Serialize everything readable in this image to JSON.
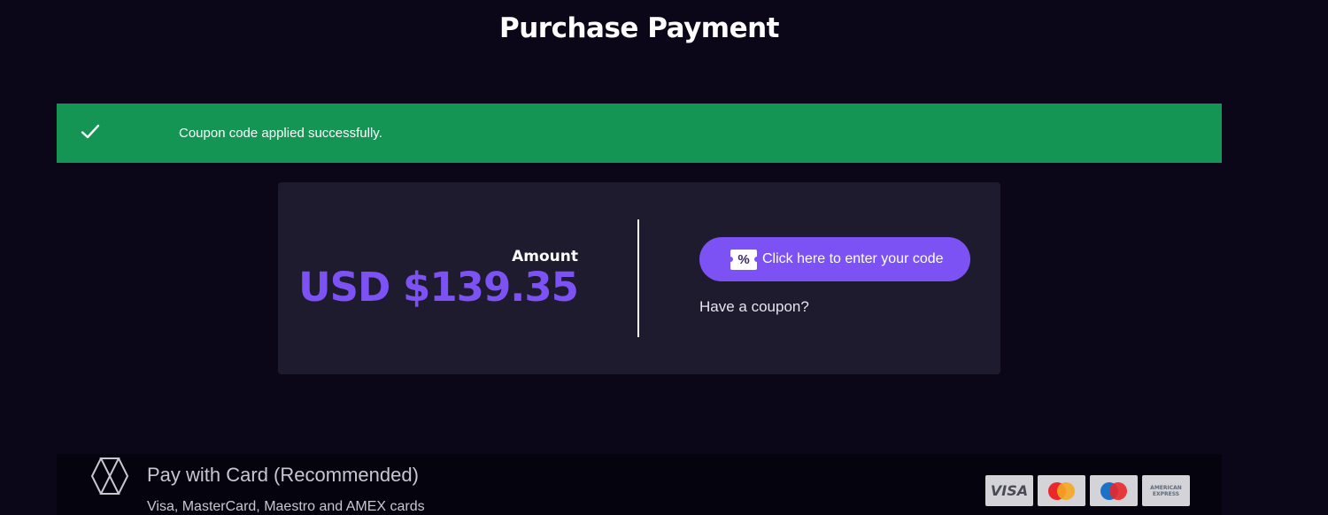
{
  "page": {
    "title": "Purchase Payment"
  },
  "alert": {
    "message": "Coupon code applied successfully.",
    "icon": "check-icon",
    "color": "#159553"
  },
  "summary": {
    "amount_label": "Amount",
    "amount_value": "USD $139.35",
    "accent_color": "#7c52f4",
    "coupon_button_label": "Click here to enter your code",
    "coupon_button_icon": "percent-ticket-icon",
    "coupon_prompt": "Have a coupon?"
  },
  "payment_method": {
    "title": "Pay with Card (Recommended)",
    "subtitle": "Visa, MasterCard, Maestro and AMEX cards",
    "icon": "payment-provider-logo-icon",
    "cards": [
      {
        "name": "visa",
        "label": "VISA"
      },
      {
        "name": "mastercard",
        "label": ""
      },
      {
        "name": "maestro",
        "label": ""
      },
      {
        "name": "amex",
        "label": "AMERICAN EXPRESS"
      }
    ]
  }
}
